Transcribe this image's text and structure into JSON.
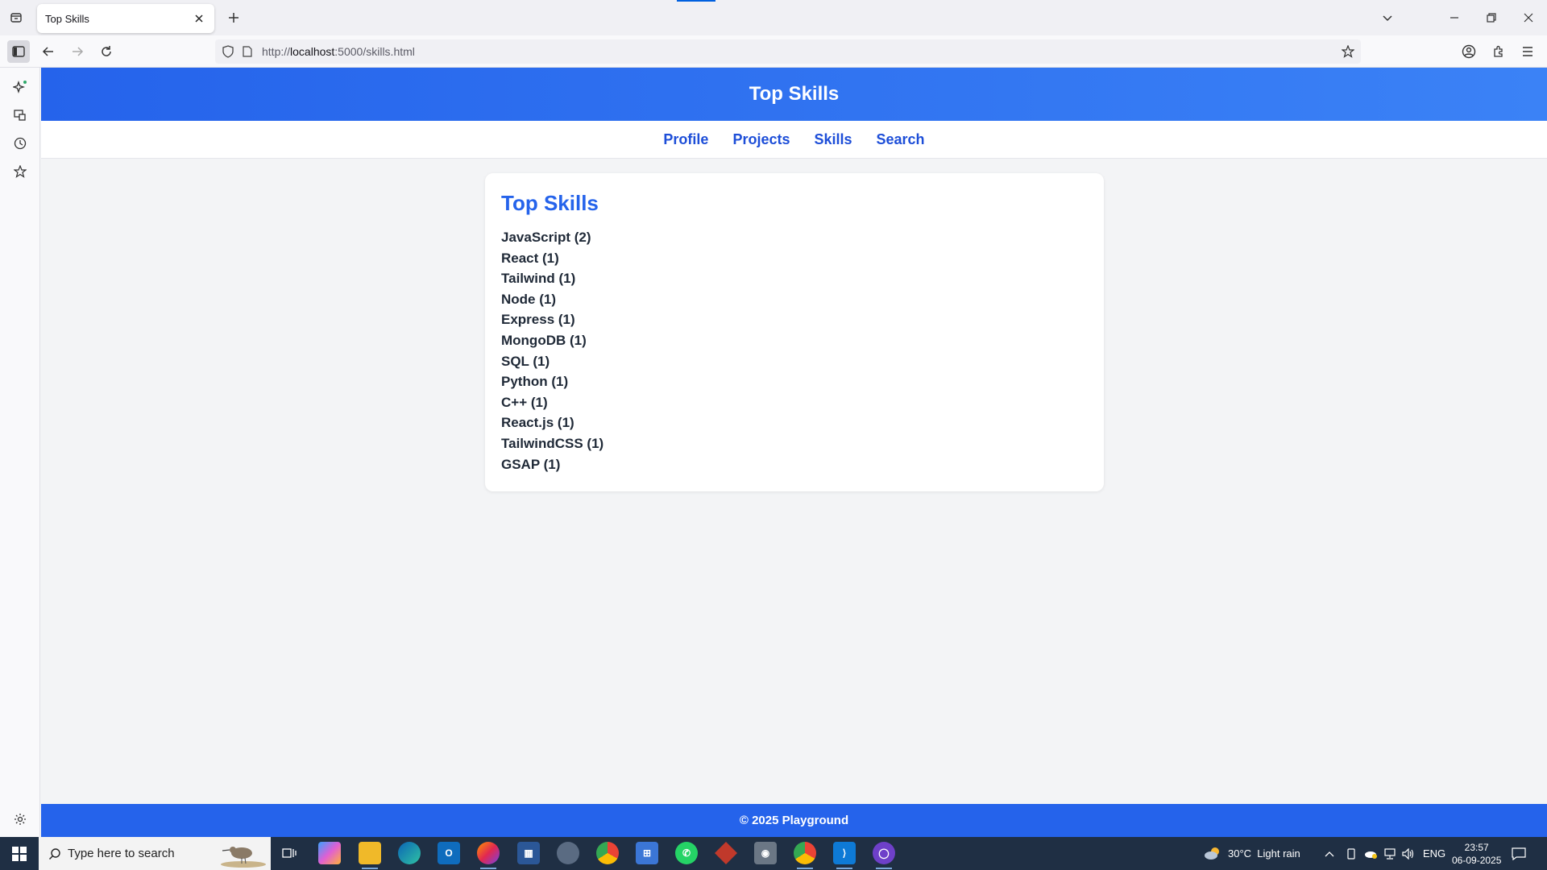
{
  "browser": {
    "tab_title": "Top Skills",
    "url_prefix": "http://",
    "url_host": "localhost",
    "url_path": ":5000/skills.html"
  },
  "site": {
    "header_title": "Top Skills",
    "nav": [
      "Profile",
      "Projects",
      "Skills",
      "Search"
    ],
    "card_title": "Top Skills",
    "skills": [
      "JavaScript (2)",
      "React (1)",
      "Tailwind (1)",
      "Node (1)",
      "Express (1)",
      "MongoDB (1)",
      "SQL (1)",
      "Python (1)",
      "C++ (1)",
      "React.js (1)",
      "TailwindCSS (1)",
      "GSAP (1)"
    ],
    "footer": "© 2025 Playground"
  },
  "taskbar": {
    "search_placeholder": "Type here to search",
    "weather": "30°C  Light rain",
    "language": "ENG",
    "time": "23:57",
    "date": "06-09-2025"
  },
  "colors": {
    "primary": "#2563eb",
    "link": "#1d4ed8",
    "taskbar": "#1f2f44"
  }
}
